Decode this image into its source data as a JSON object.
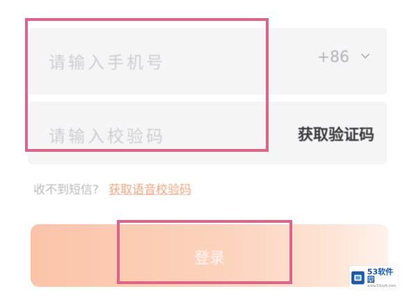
{
  "phone": {
    "placeholder": "请输入手机号",
    "country_code": "+86"
  },
  "code": {
    "placeholder": "请输入校验码",
    "get_code_label": "获取验证码"
  },
  "hint": {
    "text": "收不到短信?",
    "voice_link": "获取语音校验码"
  },
  "login": {
    "label": "登录"
  },
  "watermark": {
    "name": "53软件园",
    "sub": "www.53soft.com"
  },
  "colors": {
    "highlight": "#e0648a",
    "link": "#f0a27a",
    "button_start": "#fbc4a9"
  },
  "icons": {
    "dropdown": "chevron-down-icon",
    "watermark_logo": "53soft-logo-icon"
  }
}
